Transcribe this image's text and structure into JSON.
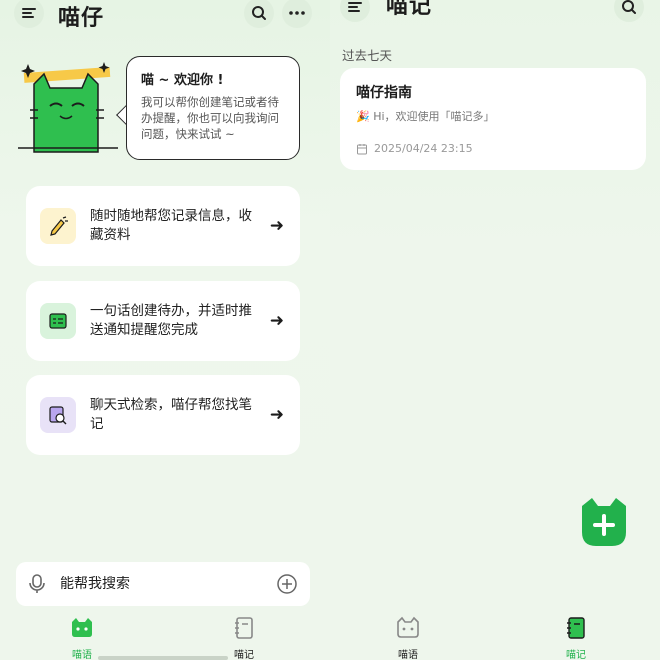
{
  "left": {
    "title": "喵仔",
    "welcome": {
      "title": "喵 ~ 欢迎你 !",
      "text": "我可以帮你创建笔记或者待办提醒，你也可以向我询问问题，快来试试 ~"
    },
    "cards": [
      {
        "icon": "pencil-note-icon",
        "text": "随时随地帮您记录信息，收藏资料"
      },
      {
        "icon": "todo-list-icon",
        "text": "一句话创建待办，并适时推送通知提醒您完成"
      },
      {
        "icon": "search-document-icon",
        "text": "聊天式检索，喵仔帮您找笔记"
      }
    ],
    "input": {
      "placeholder": "能帮我搜索"
    },
    "tabs": [
      {
        "label": "喵语",
        "active": true,
        "icon": "cat-chat-icon"
      },
      {
        "label": "喵记",
        "active": false,
        "icon": "notebook-icon"
      }
    ]
  },
  "right": {
    "title": "喵记",
    "section": "过去七天",
    "note": {
      "title": "喵仔指南",
      "snippet": "🎉 Hi，欢迎使用「喵记多」",
      "timestamp": "2025/04/24 23:15"
    },
    "tabs": [
      {
        "label": "喵语",
        "active": false,
        "icon": "cat-chat-icon"
      },
      {
        "label": "喵记",
        "active": true,
        "icon": "notebook-icon"
      }
    ]
  },
  "colors": {
    "accent": "#22b14c",
    "background": "#eef6ec",
    "card": "#ffffff",
    "yellow": "#f7c948"
  }
}
